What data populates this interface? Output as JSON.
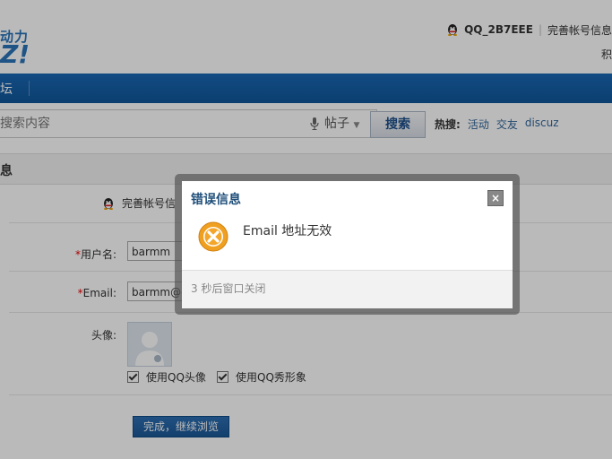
{
  "header": {
    "logo_tagline": "动力",
    "logo_text": "Z!",
    "username": "QQ_2B7EEE",
    "profile_link": "完善帐号信息",
    "points_label": "积"
  },
  "nav": {
    "items": [
      {
        "label": "坛"
      }
    ]
  },
  "search": {
    "placeholder": "搜索内容",
    "type_selected": "帖子",
    "button_label": "搜索",
    "hot_label": "热搜:",
    "hot_terms": [
      "活动",
      "交友",
      "discuz"
    ]
  },
  "page": {
    "section_title": "息",
    "complete_text": "完善帐号信",
    "username_label": "用户名:",
    "username_value": "barmm",
    "email_label": "Email:",
    "email_value": "barmm@q",
    "avatar_label": "头像:",
    "use_qq_avatar": "使用QQ头像",
    "use_qq_show": "使用QQ秀形象",
    "done_button": "完成，继续浏览"
  },
  "dialog": {
    "title": "错误信息",
    "close_symbol": "×",
    "message": "Email 地址无效",
    "footer": "3 秒后窗口关闭"
  },
  "colors": {
    "nav_bg": "#1a68b4",
    "link": "#336699",
    "dialog_title": "#1f4e7a",
    "error_icon": "#f0a020"
  }
}
